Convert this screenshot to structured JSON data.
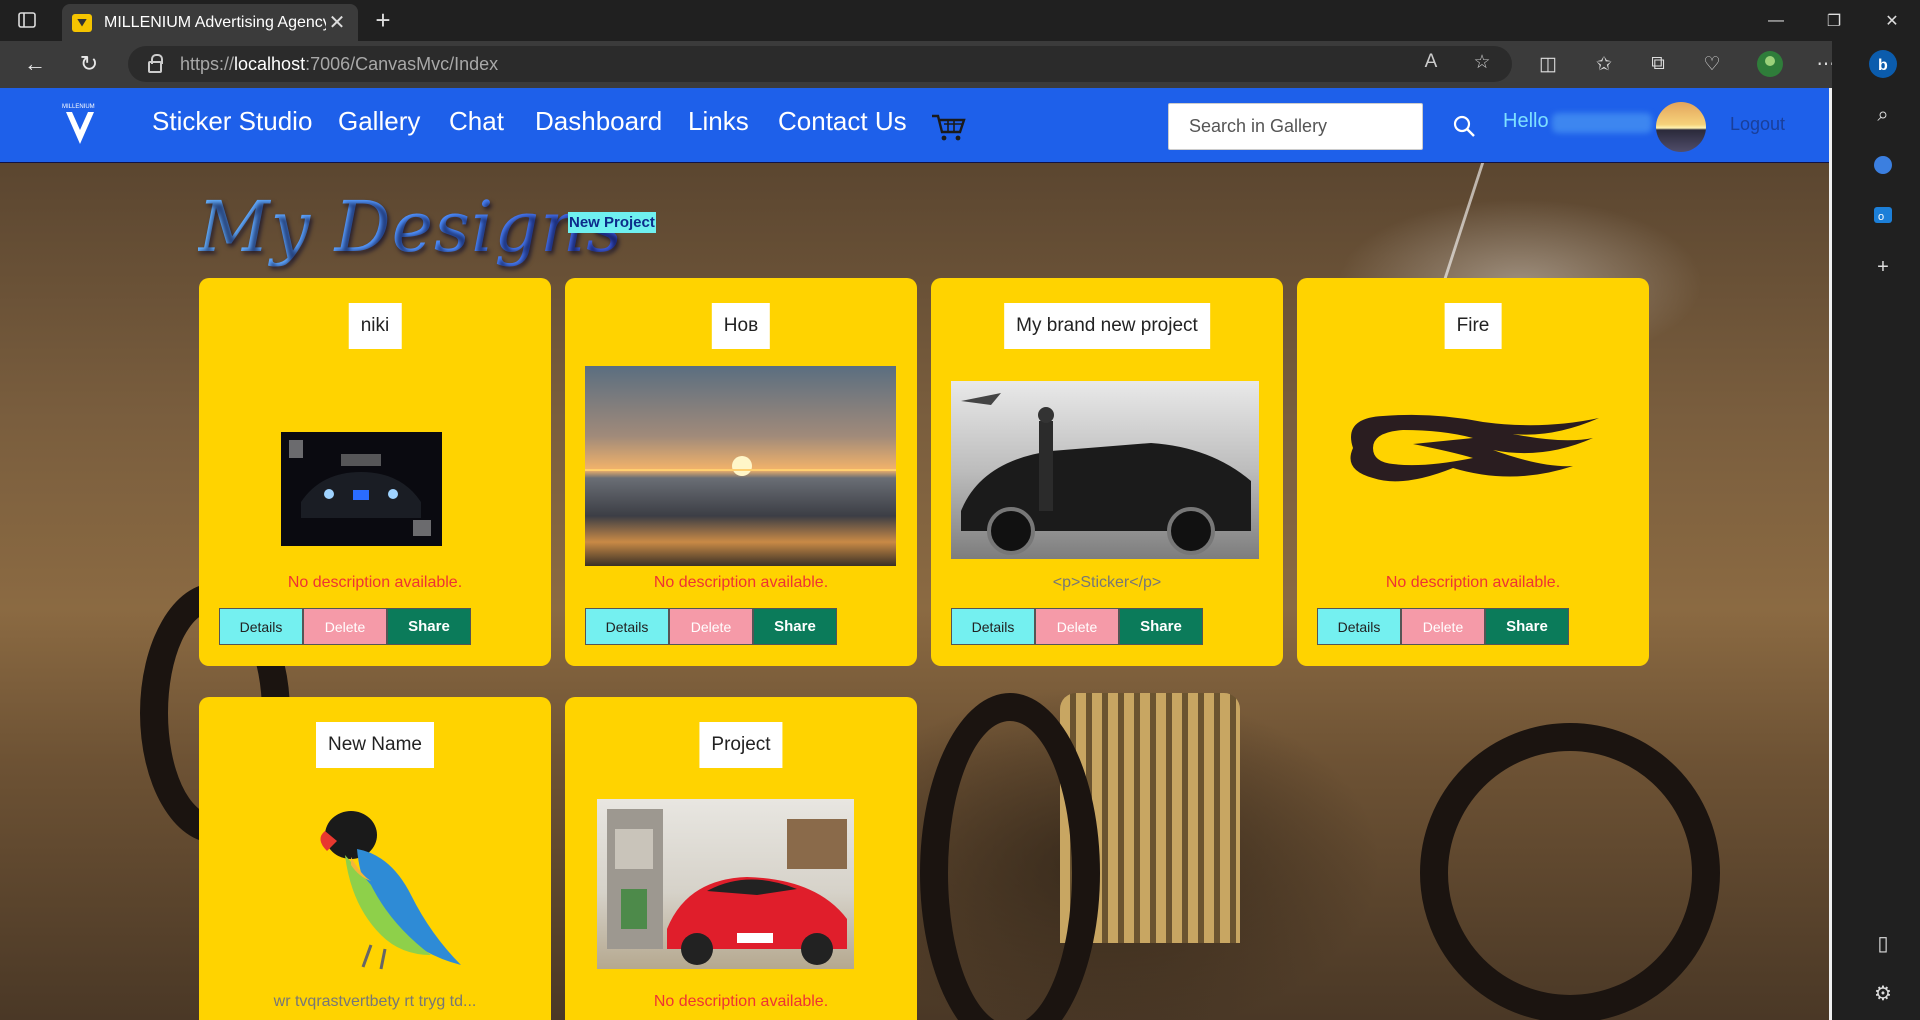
{
  "browser": {
    "tab_title": "MILLENIUM Advertising Agency",
    "url_prefix": "https://",
    "url_host": "localhost",
    "url_rest": ":7006/CanvasMvc/Index"
  },
  "navbar": {
    "links": [
      "Sticker Studio",
      "Gallery",
      "Chat",
      "Dashboard",
      "Links",
      "Contact Us"
    ],
    "search_placeholder": "Search in Gallery",
    "hello": "Hello",
    "logout": "Logout",
    "logo_text": "MILLENIUM"
  },
  "page": {
    "heading": "My Designs",
    "new_project": "New Project"
  },
  "cards": [
    {
      "title": "niki",
      "description": "No description available."
    },
    {
      "title": "Нов",
      "description": "No description available."
    },
    {
      "title": "My brand new project",
      "description": "<p>Sticker</p>"
    },
    {
      "title": "Fire",
      "description": "No description available."
    },
    {
      "title": "New Name",
      "description": "wr tvqrastvertbety rt tryg td..."
    },
    {
      "title": "Project",
      "description": "No description available."
    }
  ],
  "card_buttons": {
    "details": "Details",
    "delete": "Delete",
    "share": "Share"
  },
  "colors": {
    "navbar": "#1e60ea",
    "card": "#ffd300",
    "details_btn": "#74f0f0",
    "delete_btn": "#f59aa8",
    "share_btn": "#0b7b5a"
  }
}
